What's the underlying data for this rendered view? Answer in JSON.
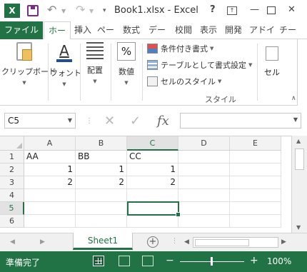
{
  "title_bar": {
    "app_icon_text": "X",
    "title": "Book1.xlsx - Excel",
    "help": "?",
    "minimize": "—",
    "close": "✕"
  },
  "tabs": [
    "ファイル",
    "ホー",
    "挿入",
    "ペー",
    "数式",
    "デー",
    "校閲",
    "表示",
    "開発",
    "アドイ",
    "チー"
  ],
  "ribbon": {
    "clipboard_label": "クリップボード",
    "font_label": "フォント",
    "font_icon": "A",
    "align_label": "配置",
    "number_label": "数値",
    "number_icon": "%",
    "styles": [
      "条件付き書式",
      "テーブルとして書式設定",
      "セルのスタイル"
    ],
    "styles_group_label": "スタイル",
    "cells_label": "セル"
  },
  "formula_bar": {
    "name_box": "C5",
    "cancel": "✕",
    "enter": "✓",
    "fx": "fx",
    "formula": ""
  },
  "columns": [
    "A",
    "B",
    "C",
    "D",
    "E"
  ],
  "selected_column": "C",
  "rows": [
    "1",
    "2",
    "3",
    "4",
    "5",
    "6"
  ],
  "selected_row": "5",
  "cells": [
    [
      "AA",
      "BB",
      "CC",
      "",
      ""
    ],
    [
      "1",
      "1",
      "1",
      "",
      ""
    ],
    [
      "2",
      "2",
      "2",
      "",
      ""
    ],
    [
      "",
      "",
      "",
      "",
      ""
    ],
    [
      "",
      "",
      "",
      "",
      ""
    ],
    [
      "",
      "",
      "",
      "",
      ""
    ]
  ],
  "sheet_tabs": [
    "Sheet1"
  ],
  "add_sheet": "+",
  "status_bar": {
    "status_text": "準備完了",
    "zoom_out": "−",
    "zoom_in": "+",
    "zoom": "100%",
    "zoom_level": 1.0
  },
  "colors": {
    "accent": "#217346",
    "app_icon": "#1f7244"
  }
}
